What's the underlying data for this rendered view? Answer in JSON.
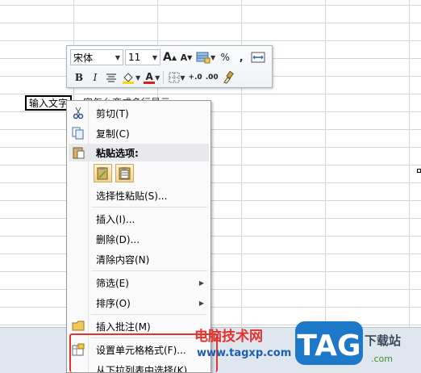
{
  "sheet": {
    "cell_text": "输入文字",
    "overflow_text": "容怎么变成多行显示"
  },
  "mini_toolbar": {
    "font_name": "宋体",
    "font_size": "11",
    "grow_font": "A",
    "shrink_font": "A",
    "percent": "%",
    "comma": ",",
    "bold": "B",
    "italic": "I",
    "font_color_glyph": "A",
    "inc_decimal": "+.0",
    "dec_decimal": ".00",
    "colors": {
      "fill": "#f5d90a",
      "font": "#d42020"
    }
  },
  "context_menu": {
    "cut": "剪切(T)",
    "copy": "复制(C)",
    "paste_options": "粘贴选项:",
    "paste_special": "选择性粘贴(S)...",
    "insert": "插入(I)...",
    "delete": "删除(D)...",
    "clear_contents": "清除内容(N)",
    "filter": "筛选(E)",
    "sort": "排序(O)",
    "insert_comment": "插入批注(M)",
    "format_cells": "设置单元格格式(F)...",
    "pick_from_list": "从下拉列表中选择(K)..."
  },
  "watermark": {
    "site_name": "电脑技术网",
    "url": "www.tagxp.com",
    "logo_text": "TAG",
    "side_text": "下载站",
    "domain": ".com"
  },
  "colors": {
    "highlight": "#e3332e",
    "logo_blue": "#1e78c8"
  }
}
